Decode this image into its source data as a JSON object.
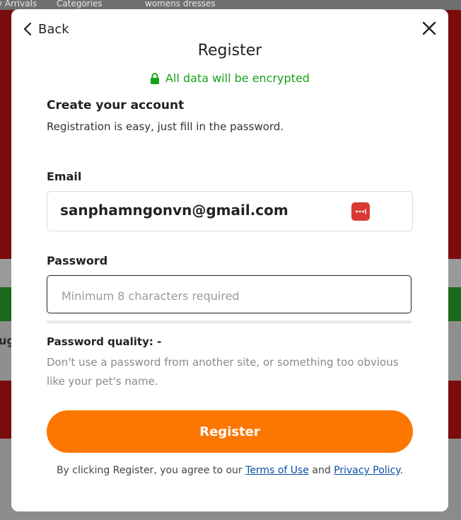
{
  "background": {
    "nav_new_arrivals": "y Arrivals",
    "nav_categories": "Categories",
    "search_text": "womens dresses",
    "side_text": "ug"
  },
  "modal": {
    "back_label": "Back",
    "title": "Register",
    "secure_text": "All data will be encrypted",
    "heading": "Create your account",
    "subheading": "Registration is easy, just fill in the password.",
    "email_label": "Email",
    "email_value": "sanphamngonvn@gmail.com",
    "password_label": "Password",
    "password_placeholder": "Minimum 8 characters required",
    "password_quality": "Password quality: -",
    "password_hint": "Don't use a password from another site, or something too obvious like your pet's name.",
    "register_button": "Register",
    "terms_prefix": "By clicking Register, you agree to our",
    "terms_link": "Terms of Use",
    "terms_and": "and",
    "privacy_link": "Privacy Policy",
    "terms_suffix": "."
  },
  "colors": {
    "accent_orange": "#fb7701",
    "secure_green": "#1aa01a",
    "link_blue": "#0a4fa8"
  },
  "icons": [
    "chevron-left-icon",
    "close-icon",
    "lock-icon",
    "password-manager-icon"
  ]
}
